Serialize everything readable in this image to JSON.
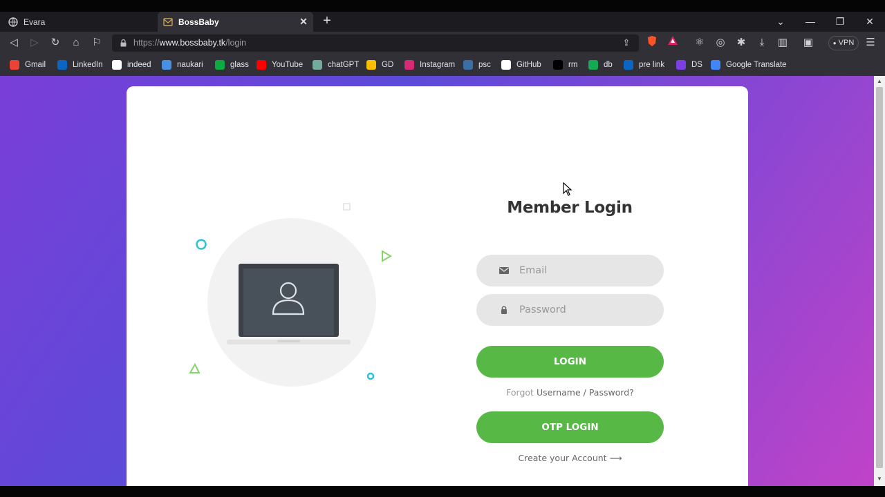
{
  "browser": {
    "tabs": [
      {
        "title": "Evara",
        "active": false
      },
      {
        "title": "BossBaby",
        "active": true
      }
    ],
    "url": {
      "scheme": "https://",
      "host": "www.bossbaby.tk",
      "path": "/login"
    },
    "vpn_label": "VPN",
    "bookmarks": [
      {
        "label": "Gmail",
        "icon": "gmail-icon",
        "color": "#ea4335"
      },
      {
        "label": "LinkedIn",
        "icon": "linkedin-icon",
        "color": "#0a66c2"
      },
      {
        "label": "indeed",
        "icon": "indeed-icon",
        "color": "#ffffff"
      },
      {
        "label": "naukari",
        "icon": "naukri-icon",
        "color": "#4a90e2"
      },
      {
        "label": "glass",
        "icon": "glassdoor-icon",
        "color": "#0caa41"
      },
      {
        "label": "YouTube",
        "icon": "youtube-icon",
        "color": "#ff0000"
      },
      {
        "label": "chatGPT",
        "icon": "chatgpt-icon",
        "color": "#74aa9c"
      },
      {
        "label": "GD",
        "icon": "drive-icon",
        "color": "#fbbc04"
      },
      {
        "label": "Instagram",
        "icon": "instagram-icon",
        "color": "#d62976"
      },
      {
        "label": "psc",
        "icon": "psc-icon",
        "color": "#3b6ea5"
      },
      {
        "label": "GitHub",
        "icon": "github-icon",
        "color": "#ffffff"
      },
      {
        "label": "rm",
        "icon": "rm-icon",
        "color": "#000000"
      },
      {
        "label": "db",
        "icon": "db-icon",
        "color": "#13aa52"
      },
      {
        "label": "pre link",
        "icon": "linkedin-icon",
        "color": "#0a66c2"
      },
      {
        "label": "DS",
        "icon": "ds-icon",
        "color": "#7b3fe4"
      },
      {
        "label": "Google Translate",
        "icon": "translate-icon",
        "color": "#4285f4"
      }
    ]
  },
  "login": {
    "title": "Member Login",
    "email_placeholder": "Email",
    "password_placeholder": "Password",
    "login_button": "LOGIN",
    "forgot_prefix": "Forgot",
    "forgot_link": "Username / Password?",
    "otp_button": "OTP LOGIN",
    "create_account": "Create your Account",
    "create_arrow": "⟶"
  },
  "colors": {
    "accent_green": "#57b846",
    "gradient_start": "#7a3ed8",
    "gradient_end": "#c043c8"
  }
}
